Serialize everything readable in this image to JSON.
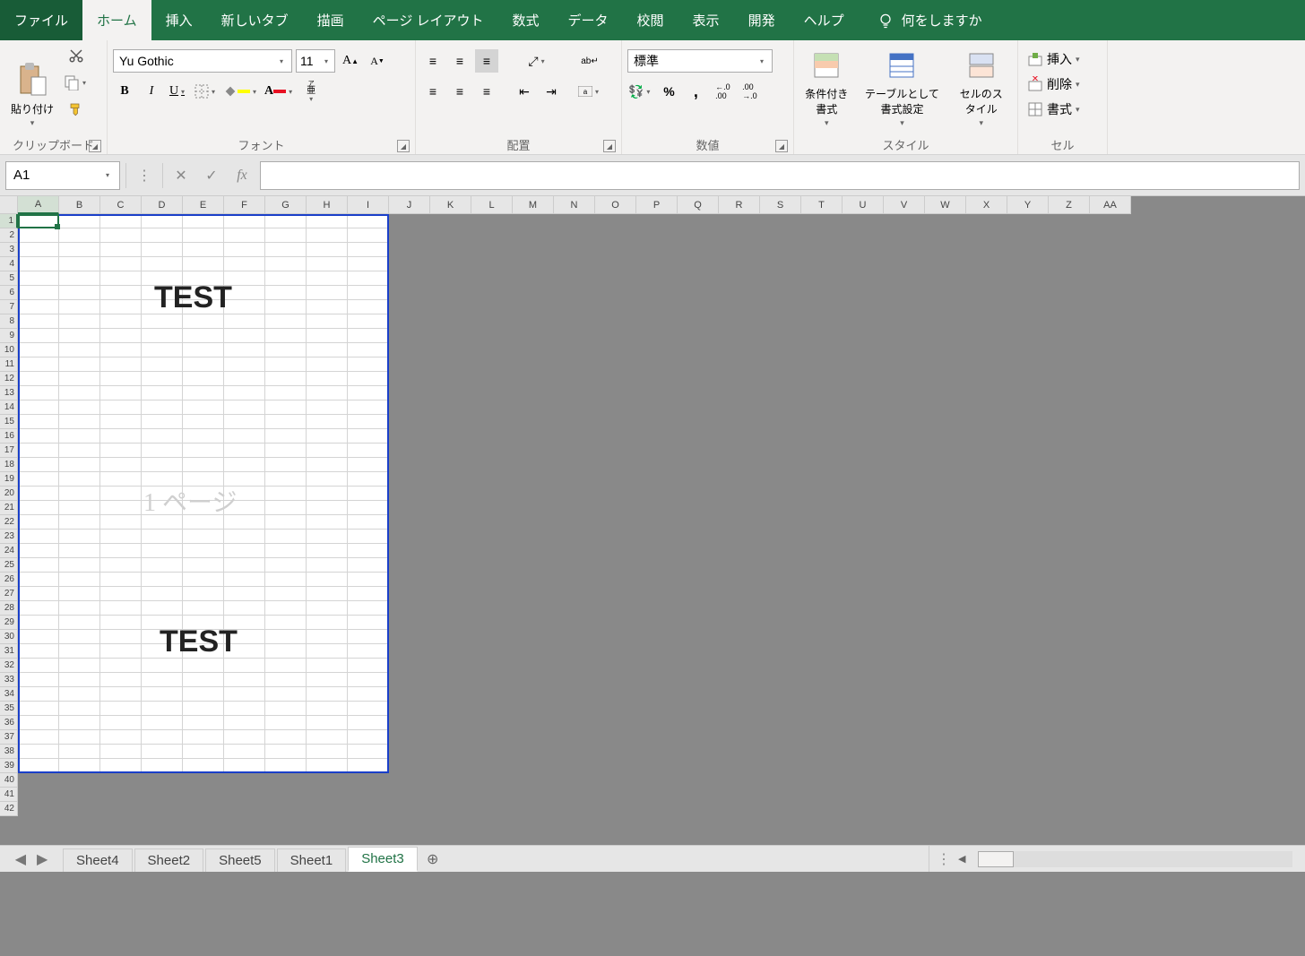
{
  "tabs": {
    "file": "ファイル",
    "home": "ホーム",
    "insert": "挿入",
    "newtab": "新しいタブ",
    "draw": "描画",
    "layout": "ページ レイアウト",
    "formulas": "数式",
    "data": "データ",
    "review": "校閲",
    "view": "表示",
    "developer": "開発",
    "help": "ヘルプ",
    "tellme": "何をしますか"
  },
  "ribbon": {
    "clipboard": {
      "paste": "貼り付け",
      "label": "クリップボード"
    },
    "font": {
      "name": "Yu Gothic",
      "size": "11",
      "label": "フォント",
      "ruby": "ア亜"
    },
    "alignment": {
      "wrap": "ab",
      "label": "配置"
    },
    "number": {
      "format": "標準",
      "label": "数値"
    },
    "styles": {
      "cond": "条件付き書式",
      "table": "テーブルとして書式設定",
      "cell": "セルのスタイル",
      "label": "スタイル"
    },
    "cells": {
      "insert": "挿入",
      "delete": "削除",
      "format": "書式",
      "label": "セル"
    }
  },
  "formula": {
    "cellref": "A1"
  },
  "grid": {
    "columns": [
      "A",
      "B",
      "C",
      "D",
      "E",
      "F",
      "G",
      "H",
      "I",
      "J",
      "K",
      "L",
      "M",
      "N",
      "O",
      "P",
      "Q",
      "R",
      "S",
      "T",
      "U",
      "V",
      "W",
      "X",
      "Y",
      "Z",
      "AA"
    ],
    "rows": 42,
    "print_cols": 9,
    "print_rows": 39,
    "watermark": "1 ページ",
    "text1": "TEST",
    "text2": "TEST"
  },
  "sheets": {
    "tabs": [
      "Sheet4",
      "Sheet2",
      "Sheet5",
      "Sheet1",
      "Sheet3"
    ],
    "active": "Sheet3"
  }
}
